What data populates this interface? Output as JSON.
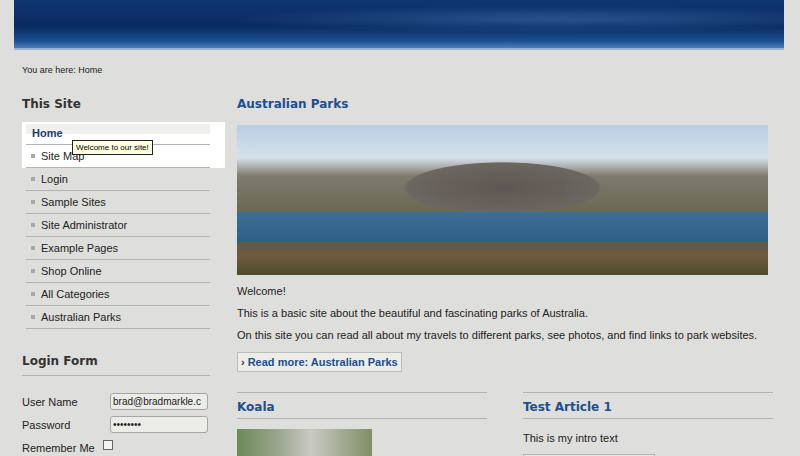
{
  "breadcrumb": "You are here: Home",
  "sidebar": {
    "title": "This Site",
    "items": [
      {
        "label": "Home",
        "selected": true,
        "highlighted": true
      },
      {
        "label": "Site Map",
        "selected": false,
        "highlighted": true
      },
      {
        "label": "Login",
        "selected": false,
        "highlighted": false
      },
      {
        "label": "Sample Sites",
        "selected": false,
        "highlighted": false
      },
      {
        "label": "Site Administrator",
        "selected": false,
        "highlighted": false
      },
      {
        "label": "Example Pages",
        "selected": false,
        "highlighted": false
      },
      {
        "label": "Shop Online",
        "selected": false,
        "highlighted": false
      },
      {
        "label": "All Categories",
        "selected": false,
        "highlighted": false
      },
      {
        "label": "Australian Parks",
        "selected": false,
        "highlighted": false
      }
    ],
    "tooltip": "Welcome to our site!"
  },
  "login_form": {
    "title": "Login Form",
    "fields": [
      {
        "label": "User Name",
        "value": "brad@bradmarkle.c"
      },
      {
        "label": "Password",
        "value": "••••••••"
      }
    ],
    "remember": {
      "label": "Remember Me",
      "checked": false
    }
  },
  "main": {
    "title": "Australian Parks",
    "paragraphs": [
      "Welcome!",
      "This is a basic site about the beautiful and fascinating parks of Australia.",
      "On this site you can read all about my travels to different parks, see photos, and find links to park websites."
    ],
    "read_more": {
      "icon": "›",
      "label": "Read more: Australian Parks"
    }
  },
  "articles": [
    {
      "title": "Koala",
      "kind": "photo",
      "intro": ""
    },
    {
      "title": "Test Article 1",
      "kind": "text",
      "intro": "This is my intro text"
    }
  ]
}
